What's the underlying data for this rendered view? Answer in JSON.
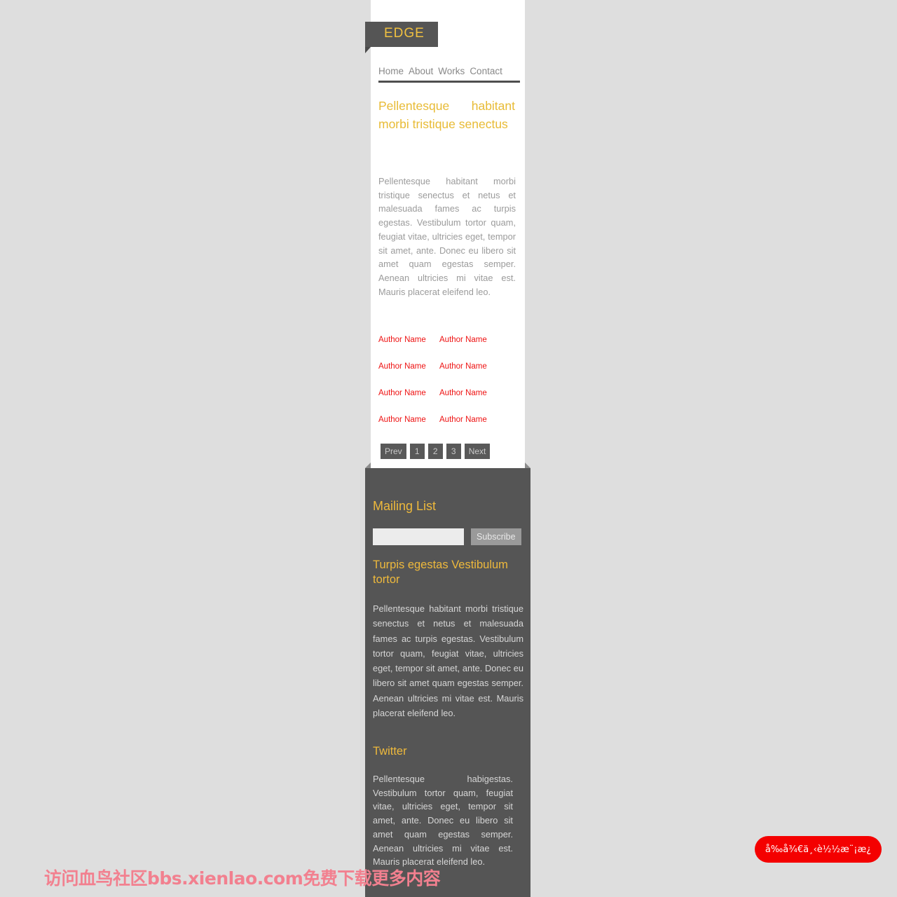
{
  "theme": {
    "page_background": "#dedede",
    "panel_dark": "#555555",
    "accent_gold": "#e8bb35",
    "link_red": "#ee1111",
    "body_gray": "#9b9b9b",
    "button_red": "#f40000",
    "watermark_pink": "#f2808f"
  },
  "brand": {
    "name": "EDGE"
  },
  "nav": {
    "items": [
      {
        "label": "Home"
      },
      {
        "label": "About"
      },
      {
        "label": "Works"
      },
      {
        "label": "Contact"
      }
    ]
  },
  "article": {
    "title": "Pellentesque habitant morbi tristique senectus",
    "body": "Pellentesque habitant morbi tristique senectus et netus et malesuada fames ac turpis egestas. Vestibulum tortor quam, feugiat vitae, ultricies eget, tempor sit amet, ante. Donec eu libero sit amet quam egestas semper. Aenean ultricies mi vitae est. Mauris placerat eleifend leo."
  },
  "authors": {
    "rows": [
      {
        "a": "Author Name",
        "b": "Author Name"
      },
      {
        "a": "Author Name",
        "b": "Author Name"
      },
      {
        "a": "Author Name",
        "b": "Author Name"
      },
      {
        "a": "Author Name",
        "b": "Author Name"
      }
    ]
  },
  "pagination": {
    "prev_label": "Prev",
    "pages": [
      {
        "label": "1"
      },
      {
        "label": "2"
      },
      {
        "label": "3"
      }
    ],
    "next_label": "Next"
  },
  "footer": {
    "mailing": {
      "heading": "Mailing List",
      "input_value": "",
      "input_placeholder": "",
      "subscribe_label": "Subscribe"
    },
    "turpis": {
      "heading": "Turpis egestas Vestibulum tortor",
      "body": "Pellentesque habitant morbi tristique senectus et netus et malesuada fames ac turpis egestas. Vestibulum tortor quam, feugiat vitae, ultricies eget, tempor sit amet, ante. Donec eu libero sit amet quam egestas semper. Aenean ultricies mi vitae est. Mauris placerat eleifend leo."
    },
    "twitter": {
      "heading": "Twitter",
      "body": "Pellentesque habigestas. Vestibulum tortor quam, feugiat vitae, ultricies eget, tempor sit amet, ante. Donec eu libero sit amet quam egestas semper. Aenean ultricies mi vitae est. Mauris placerat eleifend leo."
    }
  },
  "overlay": {
    "watermark": "访问血鸟社区bbs.xienlao.com免费下载更多内容",
    "download_button": "å‰å¾€ä¸‹è½½æ¨¡æ¿"
  }
}
